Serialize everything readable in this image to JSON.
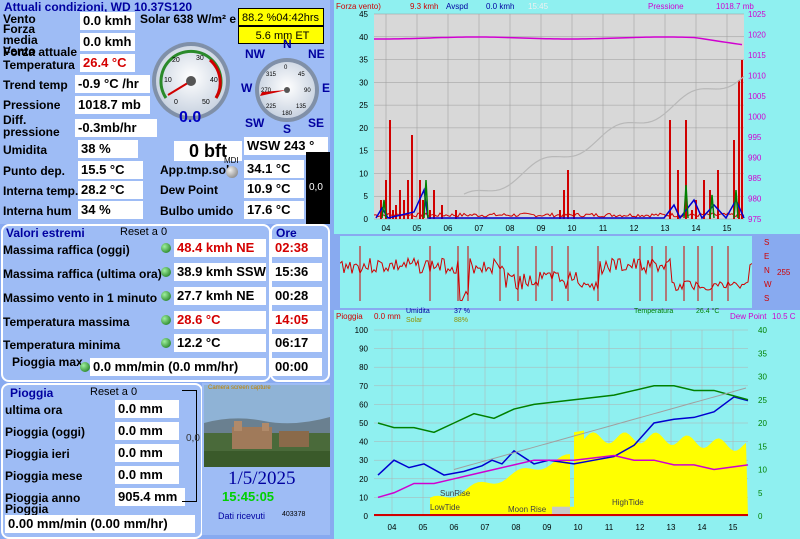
{
  "current": {
    "title": "Attuali condizioni, WD 10.37S120",
    "wind_label": "Vento",
    "wind_value": "0.0 kmh",
    "solar_value": "Solar 638 W/m² e",
    "gust_label": "Forza media Vento",
    "gust_value": "0.0 kmh",
    "actual_label": "Forza attuale",
    "temp_label": "Temperatura",
    "temp_value": "26.4 °C",
    "trend_label": "Trend temp",
    "trend_value": "-0.9 °C /hr",
    "pressure_label": "Pressione",
    "pressure_value": "1018.7 mb",
    "diff_label": "Diff. pressione",
    "diff_value": "-0.3mb/hr",
    "humidity_label": "Umidita",
    "humidity_value": "38 %",
    "dew_label": "Punto dep.",
    "dew_value": "15.5 °C",
    "intemp_label": "Interna temp.",
    "intemp_value": "28.2 °C",
    "inhum_label": "Interna hum",
    "inhum_value": "34 %",
    "apptemp_label": "App.tmp.sol",
    "apptemp_value": "34.1 °C",
    "dewpoint_label": "Dew Point",
    "dewpoint_value": "10.9 °C",
    "wetbulb_label": "Bulbo umido",
    "wetbulb_value": "17.6 °C",
    "bft": "0 bft",
    "mdi": "MDI",
    "dark_val": "0,0",
    "yellow1": "88.2 %04:42hrs",
    "yellow2": "5.6 mm ET",
    "dir_value": "WSW 243 °",
    "gauge_value": "0.0",
    "gauge_ticks": [
      "0",
      "10",
      "20",
      "30",
      "40",
      "50"
    ],
    "compass": {
      "N": "N",
      "NE": "NE",
      "E": "E",
      "SE": "SE",
      "S": "S",
      "SW": "SW",
      "W": "W",
      "NW": "NW"
    },
    "compass_ticks": [
      "0",
      "45",
      "90",
      "135",
      "180",
      "225",
      "270",
      "315"
    ]
  },
  "extremes": {
    "title": "Valori estremi",
    "reset": "Reset a 0",
    "hours_title": "Ore",
    "rows": [
      {
        "label": "Massima raffica (oggi)",
        "value": "48.4 kmh  NE",
        "time": "02:38",
        "red": true
      },
      {
        "label": "Massima raffica (ultima ora)",
        "value": "38.9 kmh SSW",
        "time": "15:36",
        "red": false
      },
      {
        "label": "Massimo vento in 1 minuto",
        "value": "27.7 kmh  NE",
        "time": "00:28",
        "red": false
      },
      {
        "label": "Temperatura massima",
        "value": "28.6 °C",
        "time": "14:05",
        "red": true
      },
      {
        "label": "Temperatura minima",
        "value": "12.2 °C",
        "time": "06:17",
        "red": false
      },
      {
        "label": "Pioggia max",
        "value": "0.0 mm/min (0.0 mm/hr)",
        "time": "00:00",
        "red": false
      }
    ]
  },
  "rain": {
    "title": "Pioggia",
    "reset": "Reset a 0",
    "last_hour_label": "ultima ora",
    "last_hour_value": "0.0 mm",
    "today_label": "Pioggia (oggi)",
    "today_value": "0.0 mm",
    "yesterday_label": "Pioggia ieri",
    "yesterday_value": "0.0 mm",
    "month_label": "Pioggia mese",
    "month_value": "0.0 mm",
    "year_label": "Pioggia anno",
    "year_value": "905.4 mm",
    "rate_label": "Pioggia",
    "rate_value": "0.00 mm/min (0.00 mm/hr)",
    "gauge_label": "0,0"
  },
  "webcam": {
    "caption": "Camera screen capture",
    "date": "1/5/2025",
    "time": "15:45:05",
    "received_label": "Dati ricevuti",
    "received_value": "403378"
  },
  "graph_top": {
    "header_left": "Forza vento)",
    "header_speed": "9.3 kmh",
    "header_avg_label": "Avspd",
    "header_avg": "0.0 kmh",
    "header_time": "15:45",
    "header_pressure_label": "Pressione",
    "header_pressure": "1018.7 mb",
    "left_ticks": [
      "45",
      "40",
      "35",
      "30",
      "25",
      "20",
      "15",
      "10",
      "5",
      "0"
    ],
    "right_ticks": [
      "1025",
      "1020",
      "1015",
      "1010",
      "1005",
      "1000",
      "995",
      "990",
      "985",
      "980",
      "975"
    ],
    "x_ticks": [
      "04",
      "05",
      "06",
      "07",
      "08",
      "09",
      "10",
      "11",
      "12",
      "13",
      "14",
      "15"
    ]
  },
  "graph_dir": {
    "labels": [
      "S",
      "E",
      "N",
      "W",
      "S"
    ],
    "value": "255"
  },
  "graph_bottom": {
    "rain_label": "Pioggia",
    "rain_value": "0.0 mm",
    "hum_label": "Umidita",
    "solar_label": "Solar",
    "hum_value": "37 %",
    "solar_value": "88%",
    "temp_label": "Temperatura",
    "temp_value": "26.4 °C",
    "dew_label": "Dew Point",
    "dew_value": "10.5 C",
    "left_ticks": [
      "100",
      "90",
      "80",
      "70",
      "60",
      "50",
      "40",
      "30",
      "20",
      "10",
      "0"
    ],
    "right_ticks": [
      "40",
      "35",
      "30",
      "25",
      "20",
      "15",
      "10",
      "5",
      "0"
    ],
    "x_ticks": [
      "04",
      "05",
      "06",
      "07",
      "08",
      "09",
      "10",
      "11",
      "12",
      "13",
      "14",
      "15"
    ],
    "annotations": {
      "sunrise": "SunRise",
      "lowtide": "LowTide",
      "moonrise": "Moon Rise",
      "hightide": "HighTide"
    }
  }
}
